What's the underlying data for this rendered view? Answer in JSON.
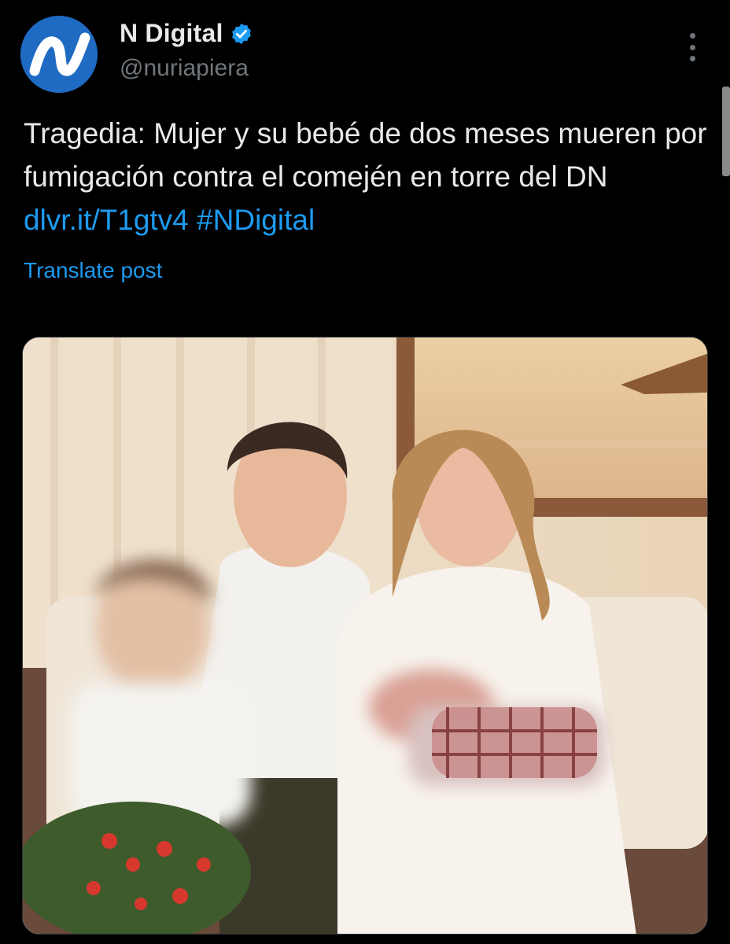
{
  "account": {
    "display_name": "N Digital",
    "handle": "@nuriapiera",
    "avatar_icon": "n-digital-logo",
    "verified_icon": "verified-badge-icon",
    "verified_color": "#1d9bf0"
  },
  "post": {
    "text": "Tragedia: Mujer y su bebé de dos meses mueren por fumigación contra el comején en torre del DN ",
    "link": "dlvr.it/T1gtv4",
    "hashtag": "#NDigital",
    "translate_label": "Translate post"
  },
  "colors": {
    "background": "#000000",
    "text": "#e7e9ea",
    "secondary": "#71767b",
    "accent": "#1d9bf0"
  }
}
